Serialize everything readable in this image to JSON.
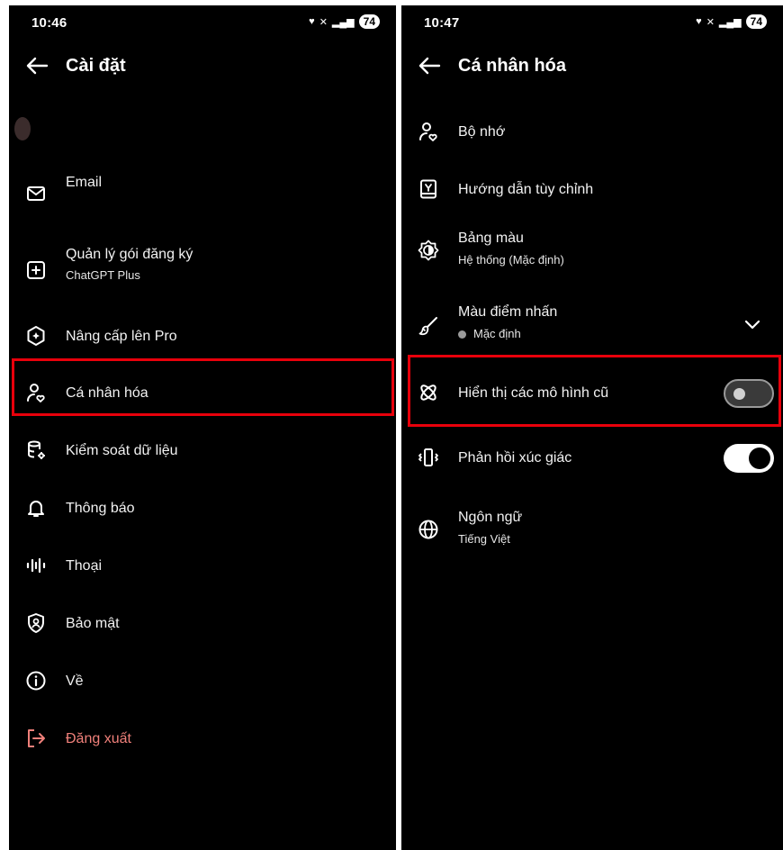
{
  "left": {
    "status": {
      "time": "10:46",
      "battery": "74"
    },
    "title": "Cài đặt",
    "items": [
      {
        "label": "Email",
        "icon": "mail-icon"
      },
      {
        "label": "Quản lý gói đăng ký",
        "sub": "ChatGPT Plus",
        "icon": "plus-square-icon"
      },
      {
        "label": "Nâng cấp lên Pro",
        "icon": "pro-badge-icon"
      },
      {
        "label": "Cá nhân hóa",
        "icon": "person-heart-icon"
      },
      {
        "label": "Kiểm soát dữ liệu",
        "icon": "database-gear-icon"
      },
      {
        "label": "Thông báo",
        "icon": "bell-icon"
      },
      {
        "label": "Thoại",
        "icon": "waveform-icon"
      },
      {
        "label": "Bảo mật",
        "icon": "shield-user-icon"
      },
      {
        "label": "Về",
        "icon": "info-icon"
      },
      {
        "label": "Đăng xuất",
        "icon": "logout-icon"
      }
    ]
  },
  "right": {
    "status": {
      "time": "10:47",
      "battery": "74"
    },
    "title": "Cá nhân hóa",
    "items": [
      {
        "label": "Bộ nhớ",
        "icon": "person-heart-icon"
      },
      {
        "label": "Hướng dẫn tùy chỉnh",
        "icon": "book-icon"
      },
      {
        "label": "Bảng màu",
        "sub": "Hệ thống (Mặc định)",
        "icon": "theme-icon"
      },
      {
        "label": "Màu điểm nhấn",
        "sub": "Mặc định",
        "icon": "paintbrush-icon"
      },
      {
        "label": "Hiển thị các mô hình cũ",
        "icon": "atom-icon",
        "toggle": "off"
      },
      {
        "label": "Phản hồi xúc giác",
        "icon": "vibrate-icon",
        "toggle": "on"
      },
      {
        "label": "Ngôn ngữ",
        "sub": "Tiếng Việt",
        "icon": "globe-icon"
      }
    ]
  },
  "colors": {
    "highlight": "#e8000b",
    "danger_text": "#f0807a",
    "background": "#000000"
  }
}
